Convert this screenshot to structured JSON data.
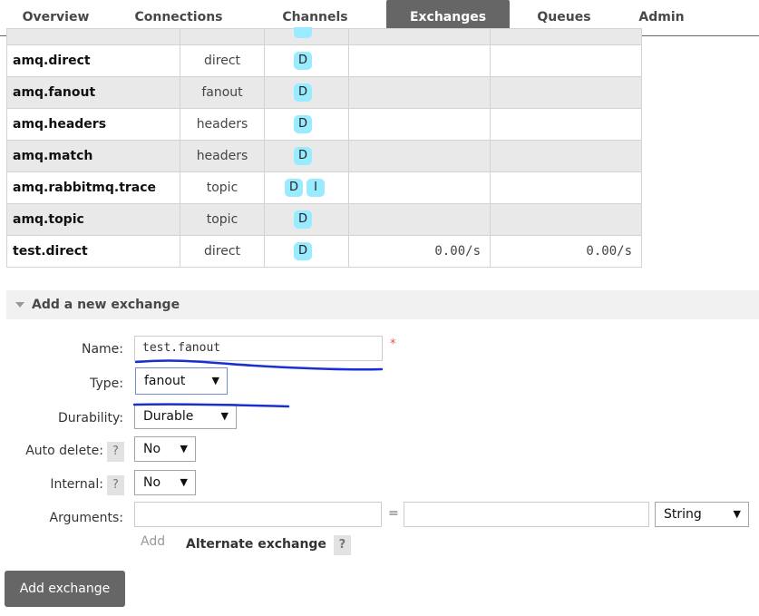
{
  "nav": {
    "tabs": [
      {
        "label": "Overview"
      },
      {
        "label": "Connections"
      },
      {
        "label": "Channels"
      },
      {
        "label": "Exchanges",
        "active": true
      },
      {
        "label": "Queues"
      },
      {
        "label": "Admin"
      }
    ]
  },
  "exchanges": {
    "rows": [
      {
        "name": "amq.direct",
        "type": "direct",
        "features": [
          "D"
        ],
        "rate_in": "",
        "rate_out": ""
      },
      {
        "name": "amq.fanout",
        "type": "fanout",
        "features": [
          "D"
        ],
        "rate_in": "",
        "rate_out": ""
      },
      {
        "name": "amq.headers",
        "type": "headers",
        "features": [
          "D"
        ],
        "rate_in": "",
        "rate_out": ""
      },
      {
        "name": "amq.match",
        "type": "headers",
        "features": [
          "D"
        ],
        "rate_in": "",
        "rate_out": ""
      },
      {
        "name": "amq.rabbitmq.trace",
        "type": "topic",
        "features": [
          "D",
          "I"
        ],
        "rate_in": "",
        "rate_out": ""
      },
      {
        "name": "amq.topic",
        "type": "topic",
        "features": [
          "D"
        ],
        "rate_in": "",
        "rate_out": ""
      },
      {
        "name": "test.direct",
        "type": "direct",
        "features": [
          "D"
        ],
        "rate_in": "0.00/s",
        "rate_out": "0.00/s"
      }
    ]
  },
  "add_exchange": {
    "section_title": "Add a new exchange",
    "name_label": "Name:",
    "name_value": "test.fanout",
    "required_mark": "*",
    "type_label": "Type:",
    "type_value": "fanout",
    "durability_label": "Durability:",
    "durability_value": "Durable",
    "auto_delete_label": "Auto delete:",
    "auto_delete_value": "No",
    "internal_label": "Internal:",
    "internal_value": "No",
    "help_mark": "?",
    "arguments_label": "Arguments:",
    "arguments_key": "",
    "arguments_equals": "=",
    "arguments_value": "",
    "arguments_type": "String",
    "add_link": "Add",
    "alternate_exchange": "Alternate exchange",
    "submit_label": "Add exchange"
  },
  "colors": {
    "active_tab": "#666666",
    "badge": "#99ebff",
    "annotation_ink": "#1a2fd0",
    "required": "#e05050"
  },
  "icons": {
    "section_toggle": "triangle-down-icon",
    "select_arrow": "caret-down-icon"
  }
}
